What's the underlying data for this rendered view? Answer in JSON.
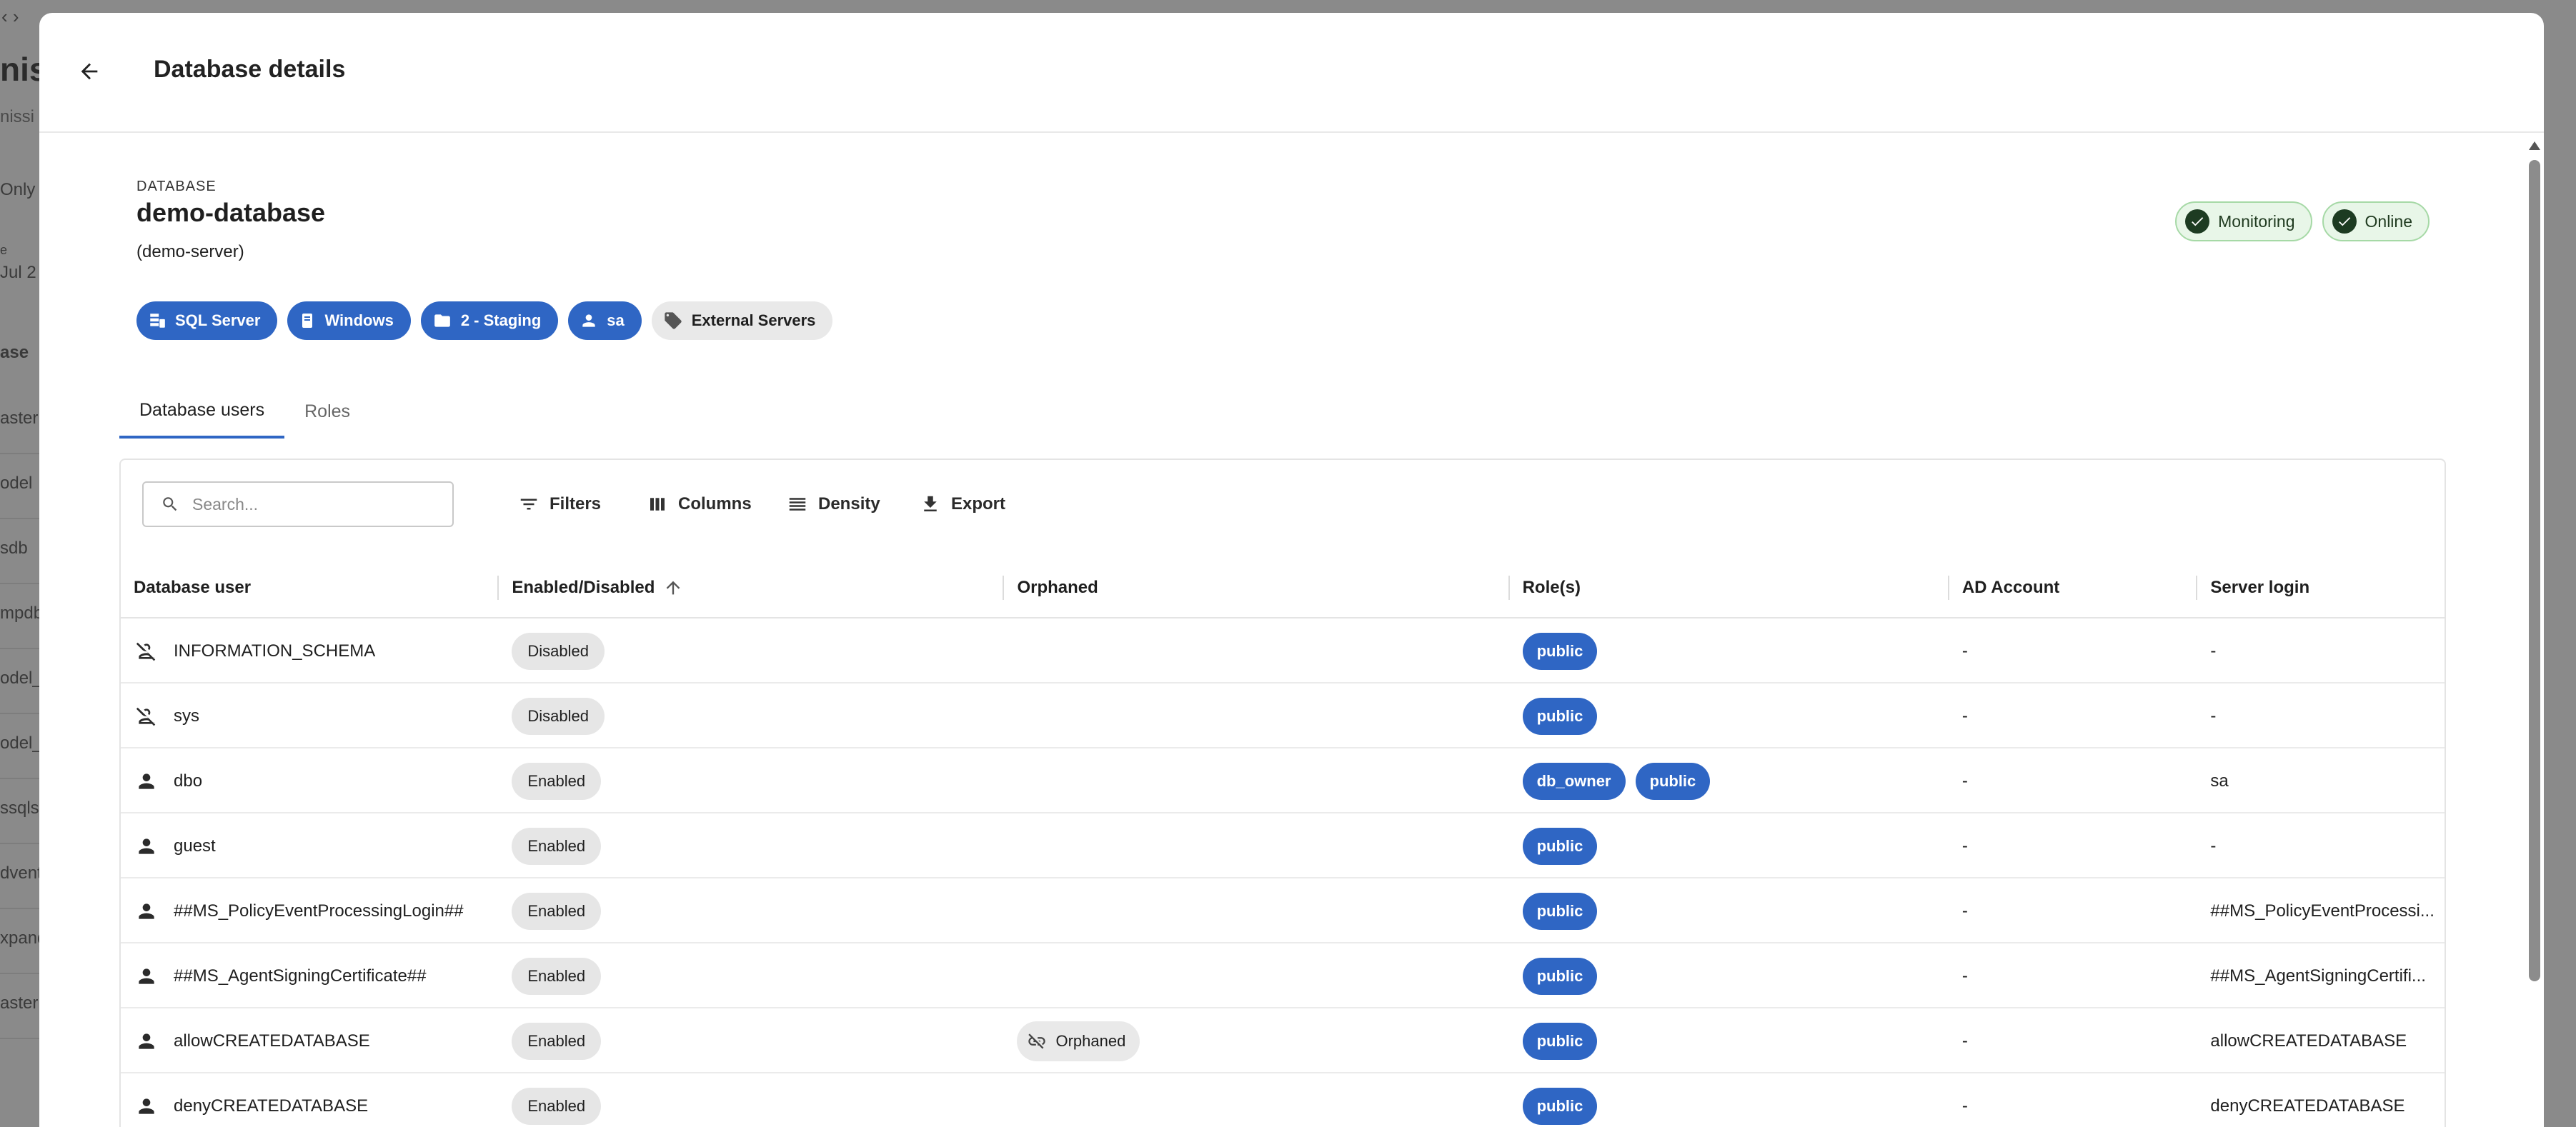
{
  "background": {
    "title_fragment": "niss",
    "subtitle_fragment": "nissi",
    "filter_fragment": "Only",
    "date_label_fragment": "e",
    "date_fragment": "Jul 2",
    "column_fragment": "ase",
    "rows": [
      "aster",
      "odel",
      "sdb",
      "mpdb",
      "odel_",
      "odel_",
      "ssqls",
      "dvent",
      "xpand",
      "aster"
    ]
  },
  "header": {
    "title": "Database details"
  },
  "database": {
    "label": "DATABASE",
    "name": "demo-database",
    "server": "(demo-server)"
  },
  "status": [
    {
      "label": "Monitoring",
      "color": "#1d3b22"
    },
    {
      "label": "Online",
      "color": "#1d3b22"
    }
  ],
  "tags": [
    {
      "label": "SQL Server",
      "icon": "sql-server-icon"
    },
    {
      "label": "Windows",
      "icon": "windows-server-icon"
    },
    {
      "label": "2 - Staging",
      "icon": "folder-icon"
    },
    {
      "label": "sa",
      "icon": "person-icon"
    },
    {
      "label": "External Servers",
      "icon": "tag-icon"
    }
  ],
  "tabs": [
    {
      "label": "Database users",
      "active": true
    },
    {
      "label": "Roles",
      "active": false
    }
  ],
  "toolbar": {
    "search_placeholder": "Search...",
    "filters": "Filters",
    "columns": "Columns",
    "density": "Density",
    "export": "Export"
  },
  "table": {
    "columns": [
      "Database user",
      "Enabled/Disabled",
      "Orphaned",
      "Role(s)",
      "AD Account",
      "Server login"
    ],
    "rows": [
      {
        "user": "INFORMATION_SCHEMA",
        "icon": "person-off-icon",
        "state": "Disabled",
        "orphaned": "",
        "roles": [
          "public"
        ],
        "ad": "-",
        "login": "-"
      },
      {
        "user": "sys",
        "icon": "person-off-icon",
        "state": "Disabled",
        "orphaned": "",
        "roles": [
          "public"
        ],
        "ad": "-",
        "login": "-"
      },
      {
        "user": "dbo",
        "icon": "person-icon",
        "state": "Enabled",
        "orphaned": "",
        "roles": [
          "db_owner",
          "public"
        ],
        "ad": "-",
        "login": "sa"
      },
      {
        "user": "guest",
        "icon": "person-icon",
        "state": "Enabled",
        "orphaned": "",
        "roles": [
          "public"
        ],
        "ad": "-",
        "login": "-"
      },
      {
        "user": "##MS_PolicyEventProcessingLogin##",
        "icon": "person-icon",
        "state": "Enabled",
        "orphaned": "",
        "roles": [
          "public"
        ],
        "ad": "-",
        "login": "##MS_PolicyEventProcessi..."
      },
      {
        "user": "##MS_AgentSigningCertificate##",
        "icon": "person-icon",
        "state": "Enabled",
        "orphaned": "",
        "roles": [
          "public"
        ],
        "ad": "-",
        "login": "##MS_AgentSigningCertifi..."
      },
      {
        "user": "allowCREATEDATABASE",
        "icon": "person-icon",
        "state": "Enabled",
        "orphaned": "Orphaned",
        "roles": [
          "public"
        ],
        "ad": "-",
        "login": "allowCREATEDATABASE"
      },
      {
        "user": "denyCREATEDATABASE",
        "icon": "person-icon",
        "state": "Enabled",
        "orphaned": "",
        "roles": [
          "public"
        ],
        "ad": "-",
        "login": "denyCREATEDATABASE"
      }
    ]
  }
}
